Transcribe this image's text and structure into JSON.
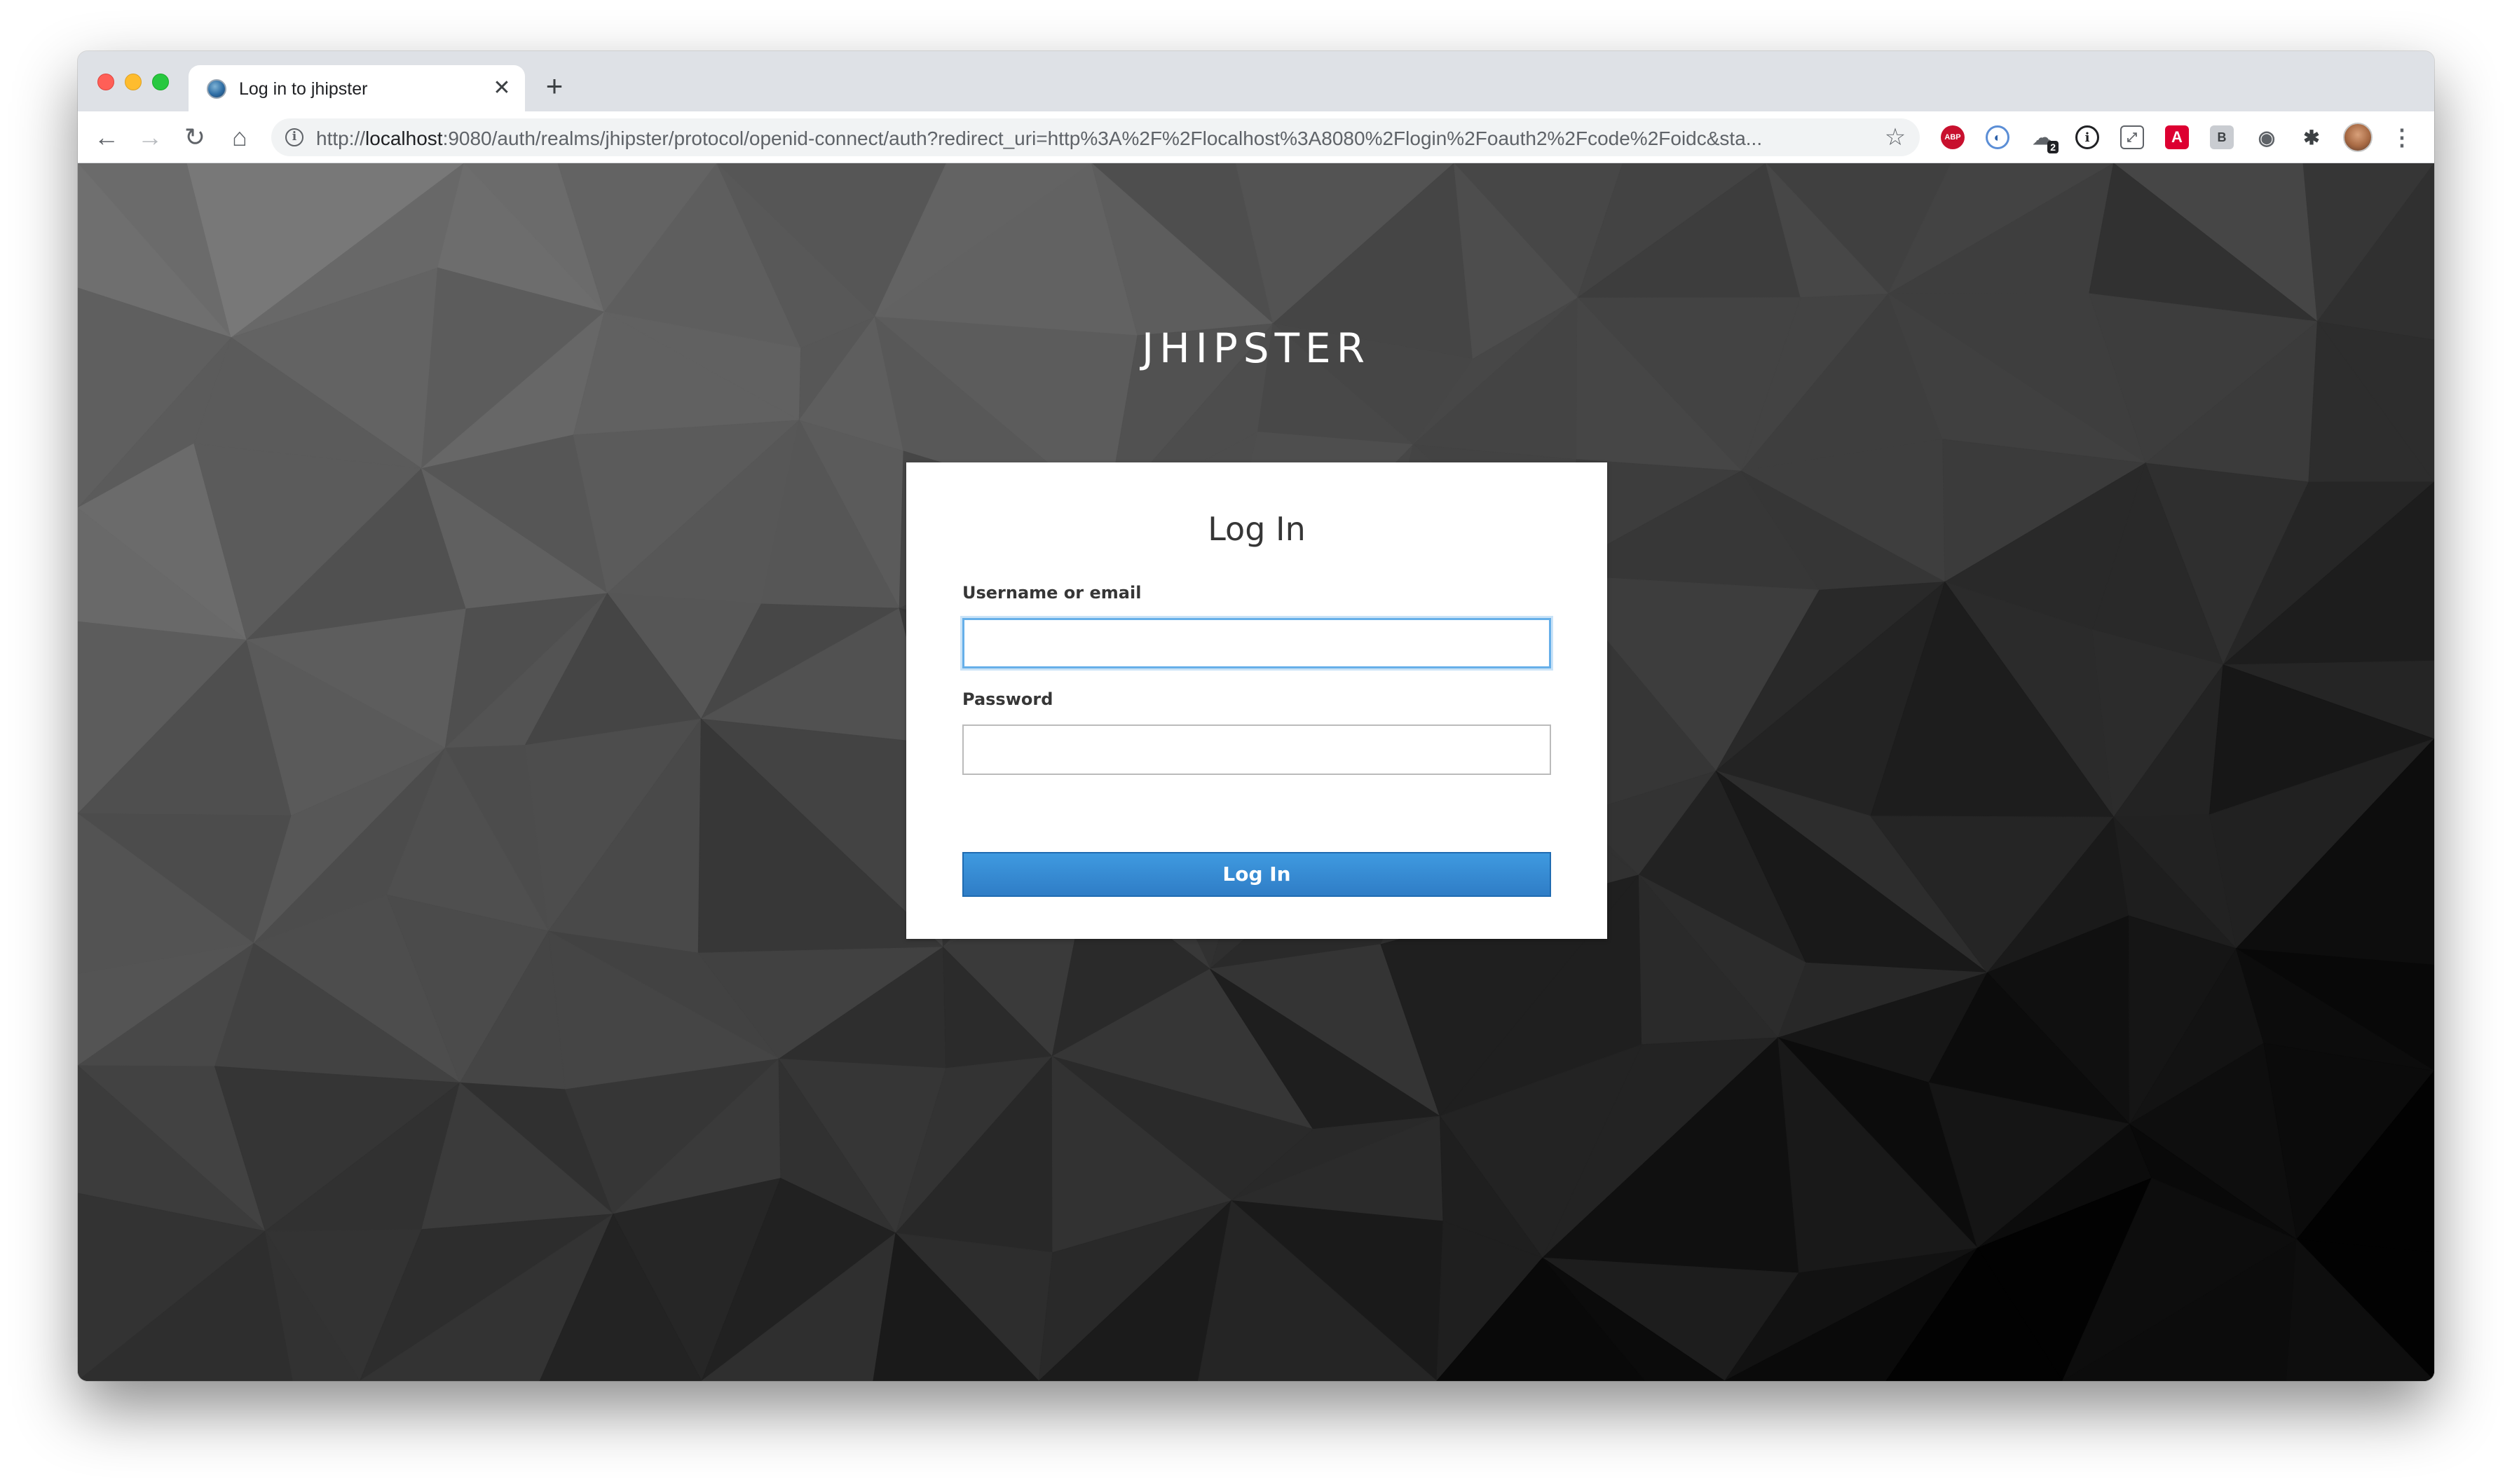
{
  "browser": {
    "tab": {
      "title": "Log in to jhipster",
      "close_glyph": "✕",
      "favicon": "jhipster-favicon"
    },
    "new_tab_glyph": "+",
    "nav": {
      "back_glyph": "←",
      "forward_glyph": "→",
      "reload_glyph": "↻",
      "home_glyph": "⌂"
    },
    "address": {
      "scheme": "http://",
      "host": "localhost",
      "rest": ":9080/auth/realms/jhipster/protocol/openid-connect/auth?redirect_uri=http%3A%2F%2Flocalhost%3A8080%2Flogin%2Foauth2%2Fcode%2Foidc&sta..."
    },
    "star_glyph": "☆",
    "extensions": [
      {
        "name": "adblock-plus-icon",
        "glyph": "ABP"
      },
      {
        "name": "onepassword-icon",
        "glyph": "ⓘ"
      },
      {
        "name": "cloud-extension-icon",
        "glyph": "☁",
        "badge": "2"
      },
      {
        "name": "info-extension-icon",
        "glyph": "i"
      },
      {
        "name": "chart-extension-icon",
        "glyph": "⤢"
      },
      {
        "name": "angular-icon",
        "glyph": "A"
      },
      {
        "name": "box-extension-icon",
        "glyph": "B"
      },
      {
        "name": "camera-icon",
        "glyph": "◉"
      },
      {
        "name": "puzzle-icon",
        "glyph": "✱"
      }
    ],
    "menu_glyph": "⋮",
    "colors": {
      "tabstrip": "#dee1e6",
      "omnibox": "#f1f3f4"
    }
  },
  "page": {
    "brand": "JHIPSTER",
    "card": {
      "title": "Log In",
      "username_label": "Username or email",
      "username_value": "",
      "password_label": "Password",
      "password_value": "",
      "submit_label": "Log In"
    },
    "colors": {
      "button": "#3085d6",
      "focus_border": "#66afe9",
      "background_dark": "#1a1a1a"
    }
  }
}
